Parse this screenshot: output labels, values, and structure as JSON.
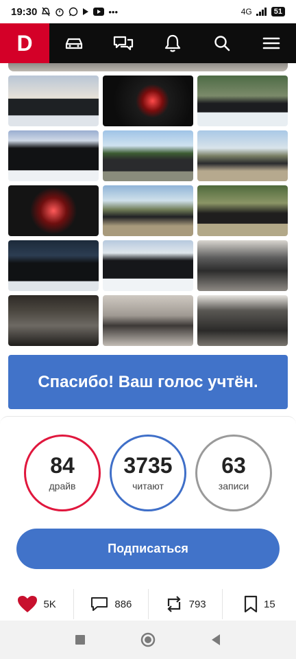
{
  "status": {
    "time": "19:30",
    "network": "4G",
    "battery": "51"
  },
  "topnav": {
    "logo": "D",
    "icons": [
      "car-icon",
      "chat-icon",
      "bell-icon",
      "search-icon",
      "menu-icon"
    ]
  },
  "gallery": {
    "photos": [
      {
        "name": "photo-car-snow-sunset",
        "bg": "linear-gradient(#b9c6d6 0%, #e8e2d8 45%, #1e2124 46%, #1e2124 78%, #dfe4ea 79%)"
      },
      {
        "name": "photo-speedometer",
        "bg": "radial-gradient(circle at 55% 50%, #ff4a4a 0%, #7a0d0d 18%, #1b1b1b 30%, #0c0c0c 70%)"
      },
      {
        "name": "photo-car-forest-snow",
        "bg": "linear-gradient(#4d6b45 0%, #7b8a6a 40%, #1c1d20 55%, #1c1d20 72%, #e8eef2 73%)"
      },
      {
        "name": "photo-car-rear-snow",
        "bg": "linear-gradient(#9aaed0 0%, #cfd8e6 20%, #111214 35%, #111214 78%, #eef1f4 79%)"
      },
      {
        "name": "photo-car-lake",
        "bg": "linear-gradient(#9fc3e6 0%, #cfe2f0 30%, #3d5c33 45%, #2a2b2d 58%, #2a2b2d 80%, #8a8c7c 81%)"
      },
      {
        "name": "photo-car-mountains",
        "bg": "linear-gradient(#a9c8e6 0%, #d8e3ea 35%, #7a8065 50%, #2a2b2e 65%, #b6a98e 80%)"
      },
      {
        "name": "photo-dashboard-red",
        "bg": "radial-gradient(circle at 50% 50%, #ff5a5a 0%, #6e0f0f 25%, #141414 45%)"
      },
      {
        "name": "photo-car-hills-roofbox",
        "bg": "linear-gradient(#90b4d8 0%, #cfe0ea 30%, #6f7c57 48%, #202124 62%, #a89a7c 80%)"
      },
      {
        "name": "photo-car-forest-road",
        "bg": "linear-gradient(#4f6a3c 0%, #8b9566 35%, #1f1e1e 55%, #1f1e1e 75%, #b2a888 76%)"
      },
      {
        "name": "photo-car-front-gate",
        "bg": "linear-gradient(#1c2a3a 0%, #2c3d52 30%, #101214 45%, #101214 80%, #e0e5ea 81%)"
      },
      {
        "name": "photo-car-rear-snow-trees",
        "bg": "linear-gradient(#b7c9de 0%, #dfe6ec 25%, #16171a 40%, #16171a 75%, #f0f3f6 76%)"
      },
      {
        "name": "photo-interior-seats",
        "bg": "linear-gradient(#d9d6d0 0%, #5b5b5b 35%, #2c2c2c 60%, #8e8a84 100%)"
      },
      {
        "name": "photo-infotainment-screen",
        "bg": "linear-gradient(#2e2a26 0%, #4a463f 30%, #6d6963 60%, #1f1d1b 100%)"
      },
      {
        "name": "photo-console-buttons",
        "bg": "linear-gradient(#cfc9c2 0%, #a09a93 40%, #3d3937 60%, #c2bcb5 100%)"
      },
      {
        "name": "photo-cargo-area",
        "bg": "linear-gradient(#e7e4df 0%, #5a5854 30%, #2b2a29 70%, #7a766f 100%)"
      }
    ]
  },
  "vote_banner": "Спасибо! Ваш голос учтён.",
  "stats": [
    {
      "value": "84",
      "label": "драйв",
      "color": "#e0173d"
    },
    {
      "value": "3735",
      "label": "читают",
      "color": "#3f6fc8"
    },
    {
      "value": "63",
      "label": "записи",
      "color": "#9a9a9a"
    }
  ],
  "subscribe_label": "Подписаться",
  "actions": {
    "likes": "5K",
    "comments": "886",
    "reposts": "793",
    "bookmarks": "15"
  },
  "colors": {
    "brand": "#d40028",
    "accent": "#4173c9"
  }
}
